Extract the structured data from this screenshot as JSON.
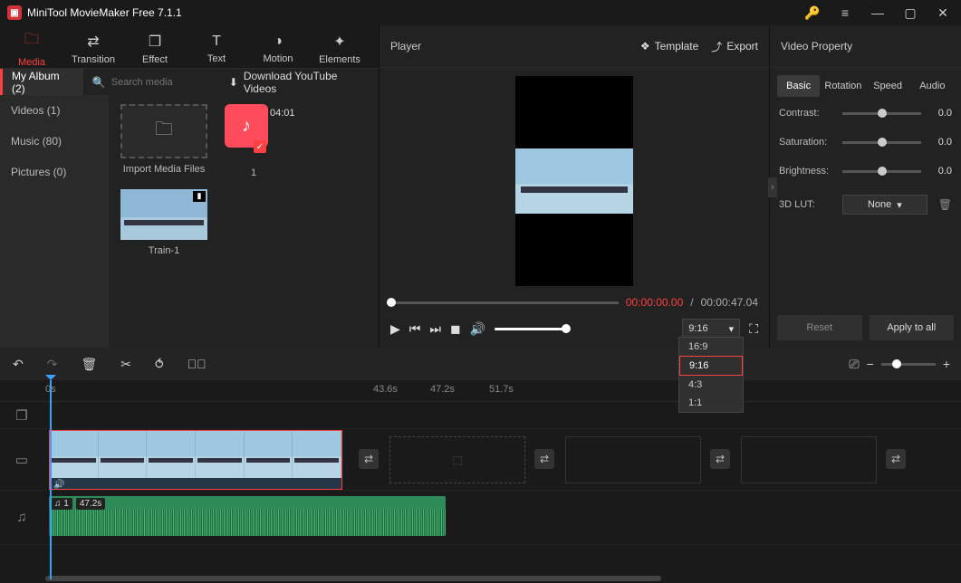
{
  "app": {
    "title": "MiniTool MovieMaker Free 7.1.1"
  },
  "mainTabs": {
    "media": "Media",
    "transition": "Transition",
    "effect": "Effect",
    "text": "Text",
    "motion": "Motion",
    "elements": "Elements"
  },
  "subTab": "My Album (2)",
  "search": {
    "placeholder": "Search media"
  },
  "download": "Download YouTube Videos",
  "cats": {
    "videos": "Videos (1)",
    "music": "Music (80)",
    "pictures": "Pictures (0)"
  },
  "grid": {
    "import": "Import Media Files",
    "musicDur": "04:01",
    "musicCount": "1",
    "trainName": "Train-1"
  },
  "player": {
    "title": "Player",
    "template": "Template",
    "export": "Export",
    "cur": "00:00:00.00",
    "sep": " / ",
    "total": "00:00:47.04",
    "ratioSelected": "9:16",
    "ratios": {
      "r169": "16:9",
      "r916": "9:16",
      "r43": "4:3",
      "r11": "1:1"
    }
  },
  "props": {
    "title": "Video Property",
    "tabs": {
      "basic": "Basic",
      "rotation": "Rotation",
      "speed": "Speed",
      "audio": "Audio"
    },
    "contrast": {
      "label": "Contrast:",
      "val": "0.0"
    },
    "saturation": {
      "label": "Saturation:",
      "val": "0.0"
    },
    "brightness": {
      "label": "Brightness:",
      "val": "0.0"
    },
    "lut": {
      "label": "3D LUT:",
      "val": "None"
    },
    "reset": "Reset",
    "apply": "Apply to all"
  },
  "timeline": {
    "r0": "0s",
    "r1": "43.6s",
    "r2": "47.2s",
    "r3": "51.7s",
    "audioIdx": "1",
    "audioDur": "47.2s"
  }
}
